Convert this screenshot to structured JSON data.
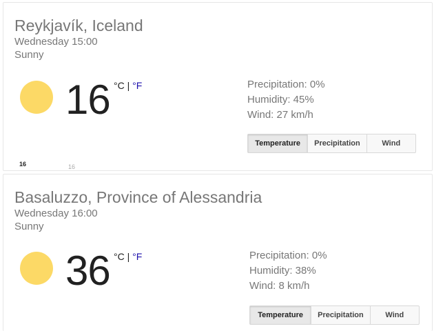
{
  "cards": [
    {
      "location": "Reykjavík, Iceland",
      "datetime": "Wednesday 15:00",
      "condition": "Sunny",
      "condition_icon": "sun-icon",
      "temperature": "16",
      "unit_c": "°C",
      "unit_sep": " | ",
      "unit_f": "°F",
      "precipitation": "Precipitation: 0%",
      "humidity": "Humidity: 45%",
      "wind": "Wind: 27 km/h",
      "tabs": [
        "Temperature",
        "Precipitation",
        "Wind"
      ],
      "active_tab": "Temperature",
      "graph_labels": [
        "16",
        "16"
      ]
    },
    {
      "location": "Basaluzzo, Province of Alessandria",
      "datetime": "Wednesday 16:00",
      "condition": "Sunny",
      "condition_icon": "sun-icon",
      "temperature": "36",
      "unit_c": "°C",
      "unit_sep": " | ",
      "unit_f": "°F",
      "precipitation": "Precipitation: 0%",
      "humidity": "Humidity: 38%",
      "wind": "Wind: 8 km/h",
      "tabs": [
        "Temperature",
        "Precipitation",
        "Wind"
      ],
      "active_tab": "Temperature"
    }
  ],
  "colors": {
    "sun": "#fcd966",
    "muted_text": "#777777",
    "temperature_text": "#212121",
    "fahrenheit_link": "#1a0dab"
  }
}
